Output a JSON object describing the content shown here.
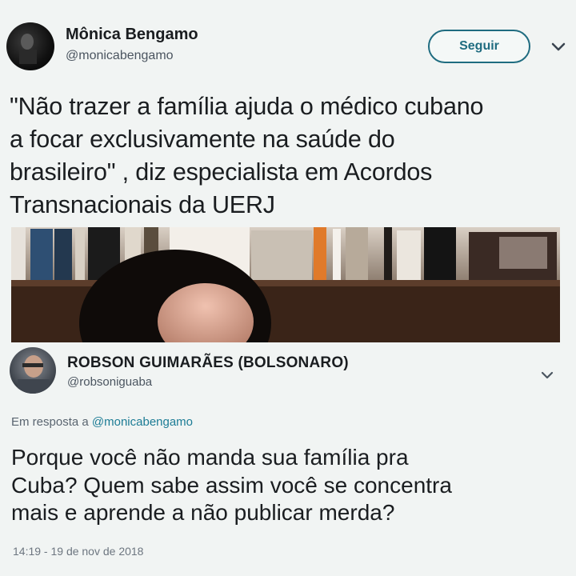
{
  "original_tweet": {
    "author_name": "Mônica Bengamo",
    "author_handle": "@monicabengamo",
    "follow_label": "Seguir",
    "text": "\"Não trazer a família ajuda o médico cubano\na focar exclusivamente na saúde do\nbrasileiro\" , diz especialista em Acordos\nTransnacionais da UERJ"
  },
  "reply_tweet": {
    "author_name": "ROBSON GUIMARÃES (BOLSONARO)",
    "author_handle": "@robsoniguaba",
    "reply_prefix": "Em resposta a ",
    "reply_mention": "@monicabengamo",
    "text": "Porque você não manda sua família pra\nCuba? Quem sabe assim você se concentra\nmais e aprende a não publicar merda?",
    "timestamp": "14:19 - 19 de nov de 2018"
  },
  "colors": {
    "accent": "#1f6c80",
    "mention": "#1c7c95",
    "background": "#f1f4f3"
  },
  "icons": {
    "menu": "chevron-down-icon"
  }
}
